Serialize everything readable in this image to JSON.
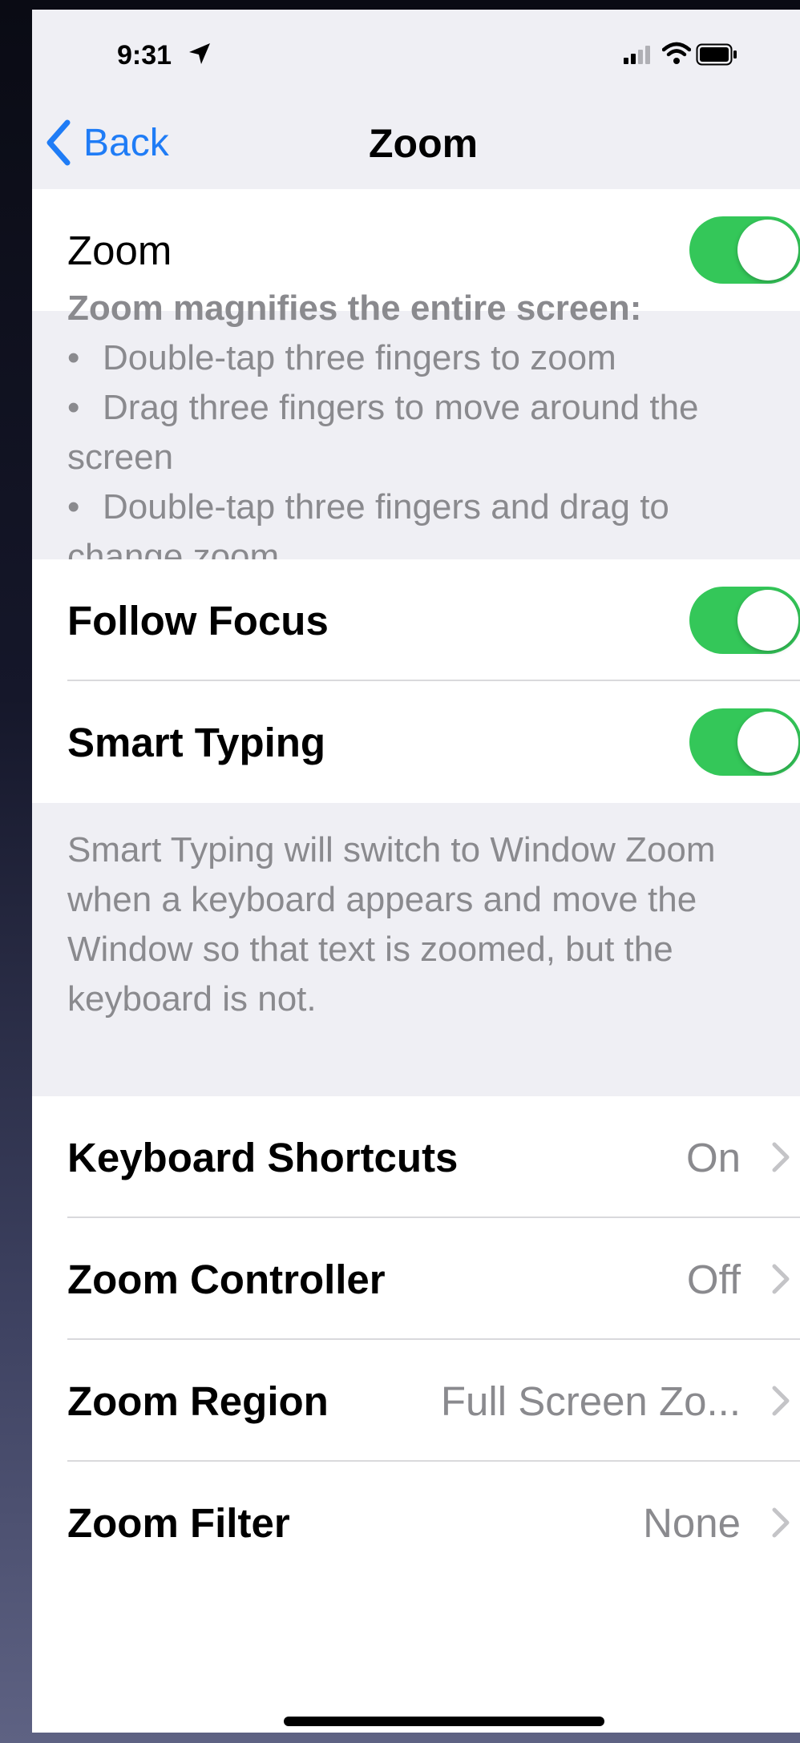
{
  "status": {
    "time": "9:31"
  },
  "nav": {
    "back_label": "Back",
    "title": "Zoom"
  },
  "zoom_row": {
    "label": "Zoom",
    "toggle_on": true
  },
  "zoom_footer": {
    "heading": "Zoom magnifies the entire screen:",
    "bullets": [
      "Double-tap three fingers to zoom",
      "Drag three fingers to move around the screen",
      "Double-tap three fingers and drag to change zoom"
    ]
  },
  "focus_group": {
    "follow_focus": {
      "label": "Follow Focus",
      "toggle_on": true
    },
    "smart_typing": {
      "label": "Smart Typing",
      "toggle_on": true
    }
  },
  "smart_typing_footer": "Smart Typing will switch to Window Zoom when a keyboard appears and move the Window so that text is zoomed, but the keyboard is not.",
  "options": [
    {
      "label": "Keyboard Shortcuts",
      "value": "On"
    },
    {
      "label": "Zoom Controller",
      "value": "Off"
    },
    {
      "label": "Zoom Region",
      "value": "Full Screen Zo..."
    },
    {
      "label": "Zoom Filter",
      "value": "None"
    }
  ],
  "colors": {
    "accent": "#1f7cf6",
    "toggle_on": "#34c759",
    "background": "#efeff4"
  }
}
